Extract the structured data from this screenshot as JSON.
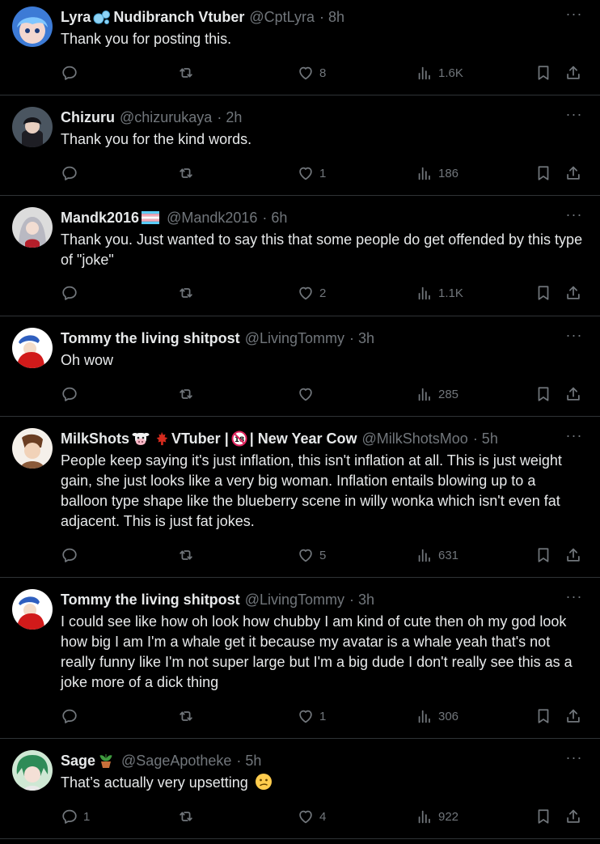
{
  "colors": {
    "background": "#000000",
    "text": "#e7e9ea",
    "muted": "#71767b",
    "divider": "#2f3336"
  },
  "icons": {
    "reply": "reply-icon",
    "retweet": "retweet-icon",
    "like": "heart-icon",
    "views": "views-icon",
    "bookmark": "bookmark-icon",
    "share": "share-icon",
    "more": "more-icon"
  },
  "tweets": [
    {
      "name_a": "Lyra",
      "emoji_a": "bubbles",
      "name_b": "Nudibranch Vtuber",
      "handle": "@CptLyra",
      "time": "· 8h",
      "text": "Thank you for posting this.",
      "replies": "",
      "retweets": "",
      "likes": "8",
      "views": "1.6K"
    },
    {
      "name_a": "Chizuru",
      "handle": "@chizurukaya",
      "time": "· 2h",
      "text": "Thank you for the kind words.",
      "replies": "",
      "retweets": "",
      "likes": "1",
      "views": "186"
    },
    {
      "name_a": "Mandk2016",
      "emoji_a": "trans-flag",
      "handle": "@Mandk2016",
      "time": "· 6h",
      "text": "Thank you. Just wanted to say this that some people do get offended by this type of \"joke\"",
      "replies": "",
      "retweets": "",
      "likes": "2",
      "views": "1.1K"
    },
    {
      "name_a": "Tommy the living shitpost",
      "handle": "@LivingTommy",
      "time": "· 3h",
      "text": "Oh wow",
      "replies": "",
      "retweets": "",
      "likes": "",
      "views": "285"
    },
    {
      "name_a": "MilkShots",
      "emoji_a": "cow",
      "emoji_b": "maple-leaf",
      "name_b": "VTuber |",
      "emoji_c": "18",
      "name_c": "| New Year Cow",
      "handle": "@MilkShotsMoo",
      "time": "· 5h",
      "text": "People keep saying it's just inflation, this isn't inflation at all. This is just weight gain, she just looks like a very big woman. Inflation entails blowing up to a balloon type shape like the blueberry scene in willy wonka which isn't even fat adjacent. This is just fat jokes.",
      "replies": "",
      "retweets": "",
      "likes": "5",
      "views": "631"
    },
    {
      "name_a": "Tommy the living shitpost",
      "handle": "@LivingTommy",
      "time": "· 3h",
      "text": "I could see like how oh look how chubby I am kind of cute then oh my god look how big I am I'm a whale get it because my avatar is a whale yeah that's not really funny like I'm not super large but I'm a big dude I don't really see this as a joke more of a dick thing",
      "replies": "",
      "retweets": "",
      "likes": "1",
      "views": "306"
    },
    {
      "name_a": "Sage",
      "emoji_a": "potted-plant",
      "handle": "@SageApotheke",
      "time": "· 5h",
      "text": "That’s actually very upsetting",
      "text_emoji": "confused-face",
      "replies": "1",
      "retweets": "",
      "likes": "4",
      "views": "922"
    }
  ]
}
